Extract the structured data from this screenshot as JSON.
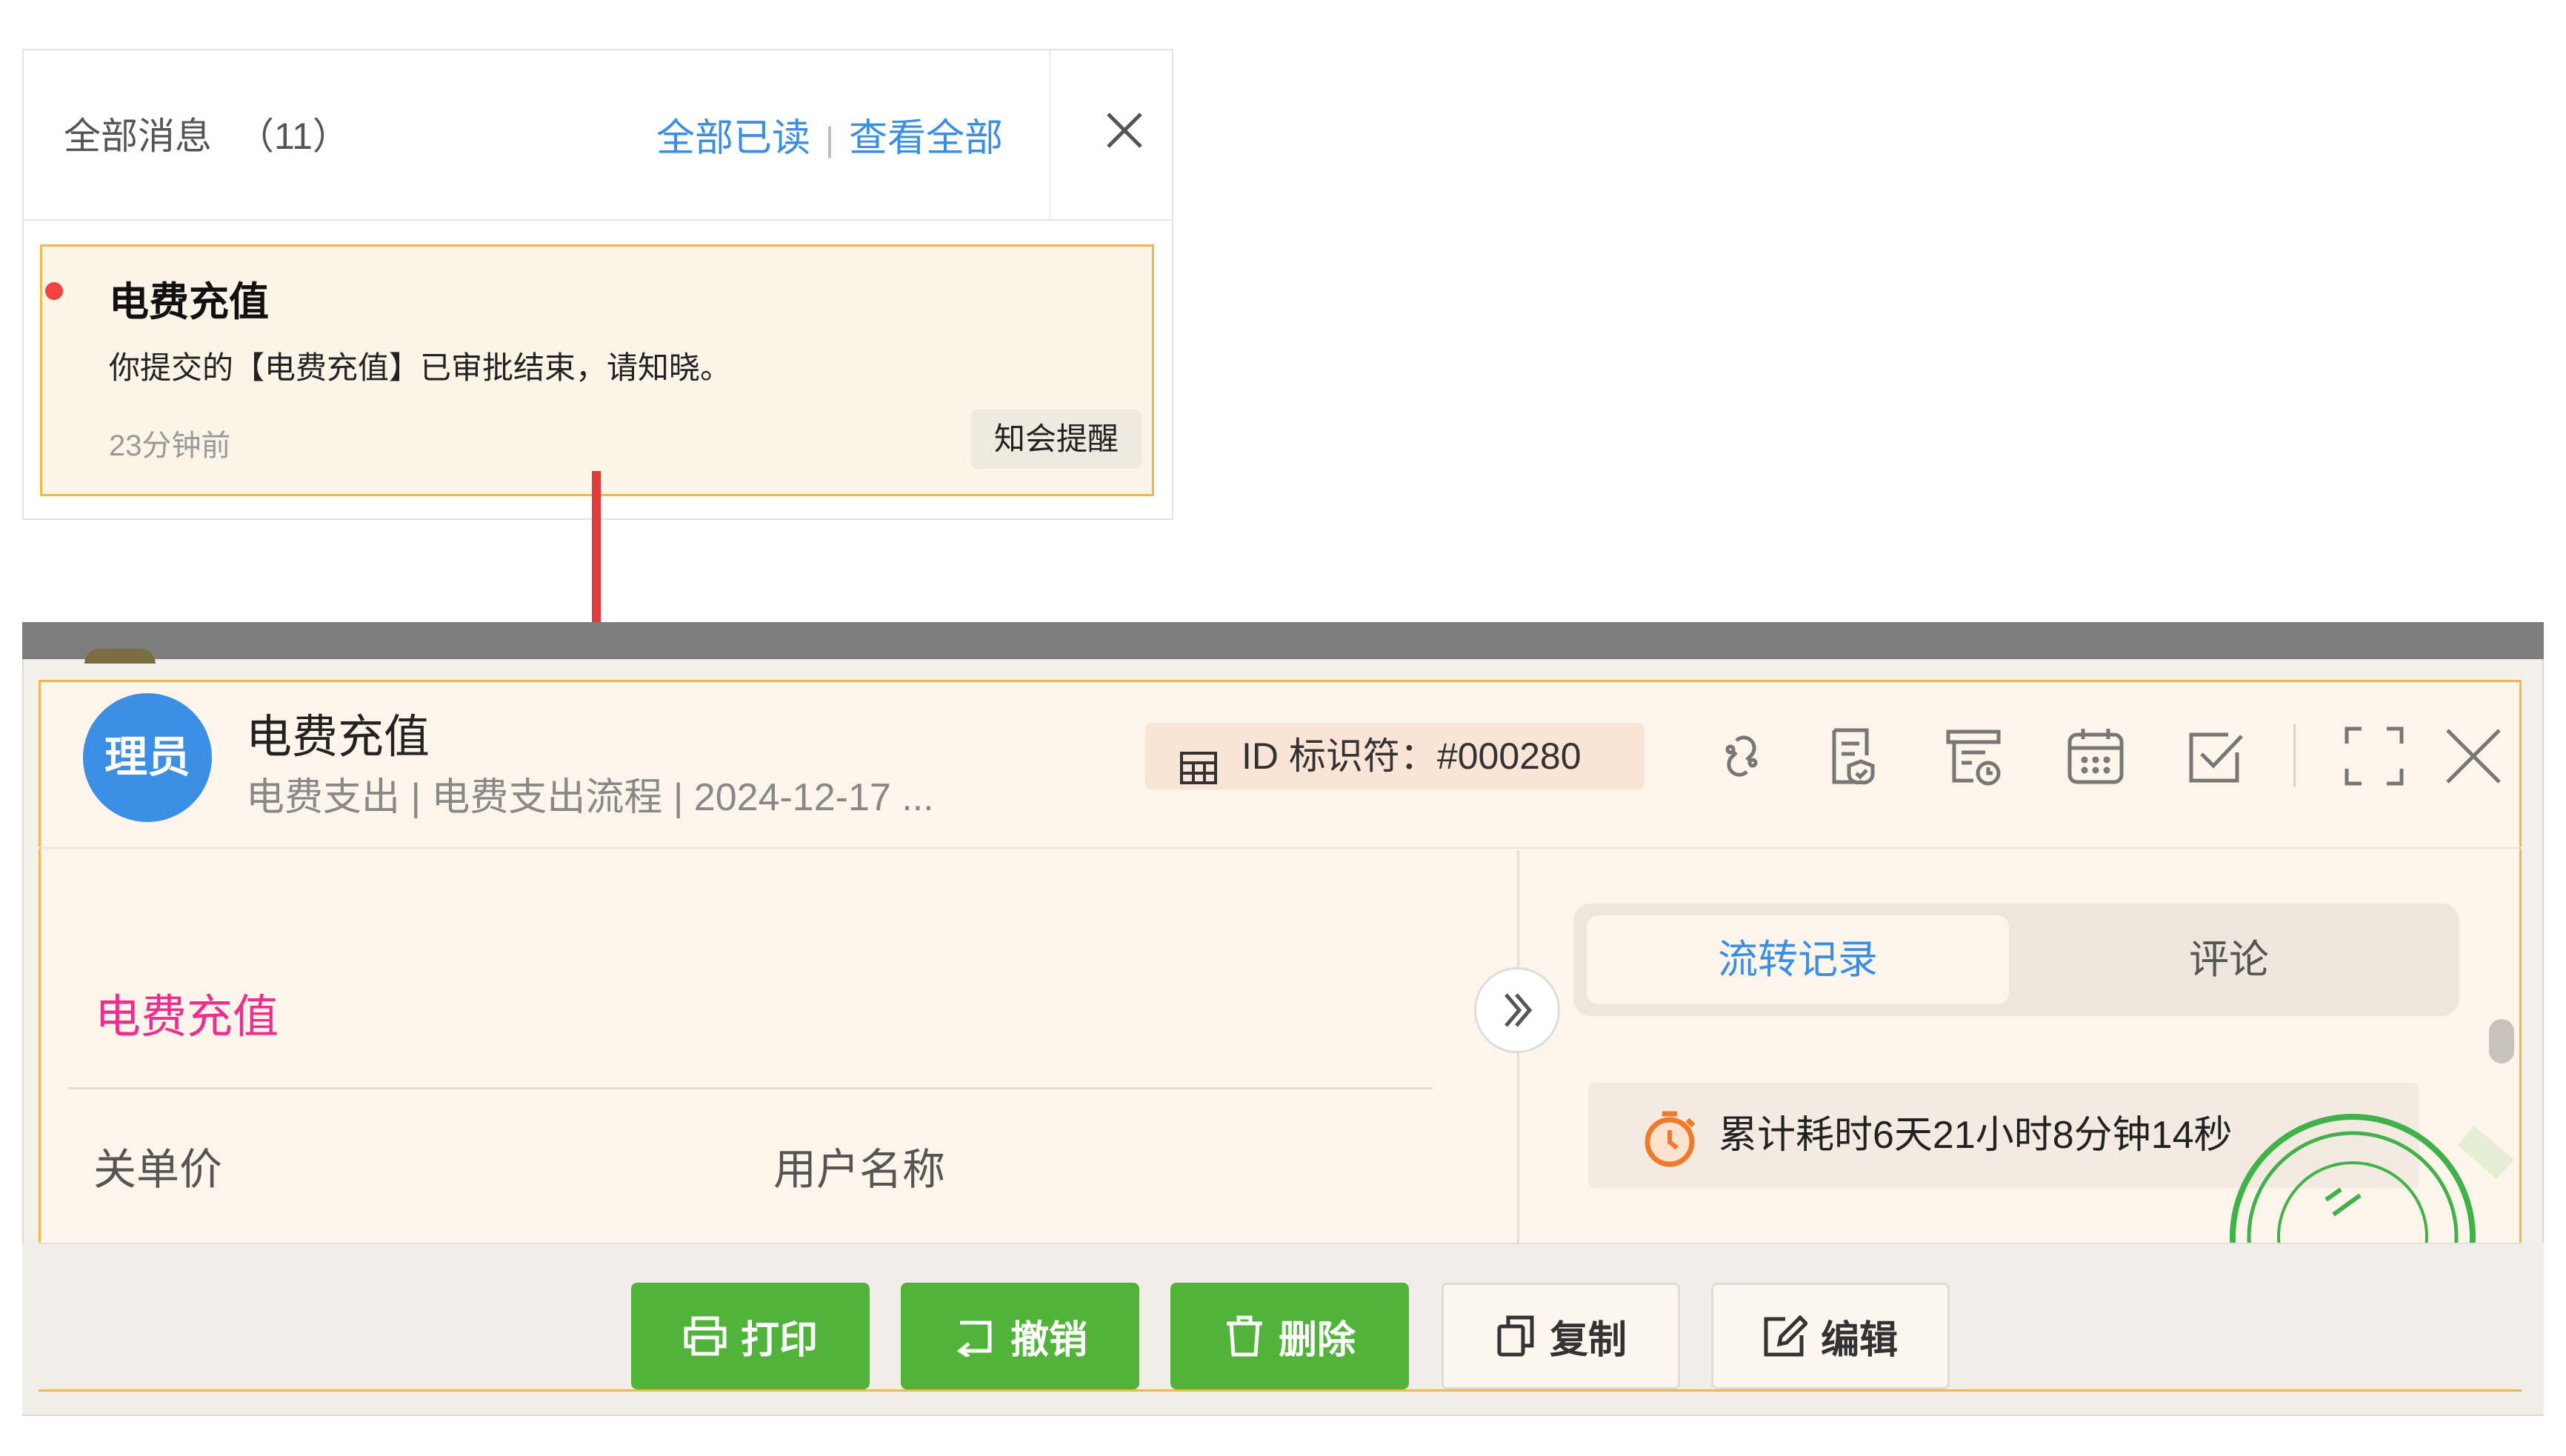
{
  "notification_panel": {
    "title": "全部消息",
    "count": "（11）",
    "mark_all_read": "全部已读",
    "separator": "|",
    "view_all": "查看全部",
    "item": {
      "title": "电费充值",
      "body": "你提交的【电费充值】已审批结束，请知晓。",
      "time": "23分钟前",
      "action": "知会提醒",
      "unread_dot_color": "#f4433c"
    }
  },
  "record_window": {
    "avatar_text": "理员",
    "title": "电费充值",
    "subtitle": "电费支出 | 电费支出流程 | 2024-12-17 ...",
    "id_label": "ID 标识符：#000280",
    "toolbar_icons": [
      "link-icon",
      "document-check-icon",
      "print-settings-icon",
      "calendar-icon",
      "checkbox-icon",
      "fullscreen-icon",
      "close-icon"
    ],
    "form": {
      "section_title": "电费充值",
      "field_1_label": "关单价",
      "field_2_label": "用户名称"
    },
    "side_panel": {
      "tabs": [
        "流转记录",
        "评论"
      ],
      "active_tab": "流转记录",
      "duration": "累计耗时6天21小时8分钟14秒"
    },
    "footer_buttons": {
      "print": "打印",
      "revoke": "撤销",
      "delete": "删除",
      "copy": "复制",
      "edit": "编辑"
    }
  },
  "colors": {
    "accent_blue": "#3a8ee6",
    "highlight_border": "#f1b64c",
    "section_pink": "#ec2f8e",
    "button_green": "#52b33a",
    "arrow_red": "#e23a3a"
  }
}
